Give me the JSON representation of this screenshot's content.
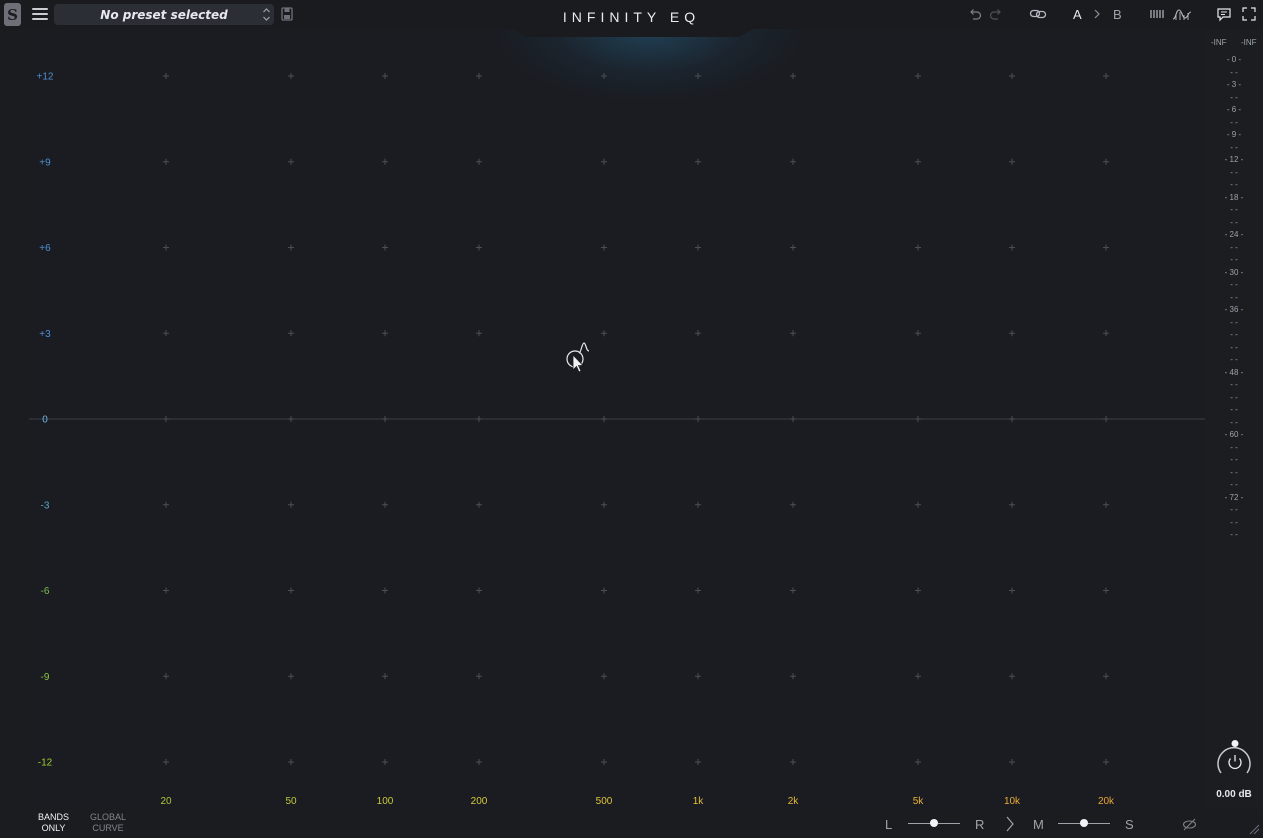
{
  "header": {
    "logo_letter": "S",
    "preset_label": "No preset selected",
    "app_title": "INFINITY EQ",
    "ab_a": "A",
    "ab_b": "B"
  },
  "graph": {
    "db_labels": [
      "+12",
      "+9",
      "+6",
      "+3",
      "0",
      "-3",
      "-6",
      "-9",
      "-12"
    ],
    "db_label_colors": [
      "#4f8fd6",
      "#4f8fd6",
      "#4f8fd6",
      "#4f8fd6",
      "#6fb3e8",
      "#5aa7c8",
      "#7cbf52",
      "#8cc63f",
      "#9bd12e"
    ],
    "freq_labels": [
      "20",
      "50",
      "100",
      "200",
      "500",
      "1k",
      "2k",
      "5k",
      "10k",
      "20k"
    ],
    "freq_label_colors": [
      "#a8c93a",
      "#c0c93a",
      "#c9c93a",
      "#d6c93a",
      "#e0c43a",
      "#e6bf3a",
      "#e8b83a",
      "#eab23a",
      "#ecab38",
      "#eea436"
    ]
  },
  "meter": {
    "left_head": "-INF",
    "right_head": "-INF",
    "ticks": [
      "0",
      "-",
      "3",
      "-",
      "6",
      "-",
      "9",
      "-",
      "12",
      "-",
      "-",
      "18",
      "-",
      "-",
      "24",
      "-",
      "-",
      "30",
      "-",
      "-",
      "36",
      "-",
      "-",
      "-",
      "-",
      "48",
      "-",
      "-",
      "-",
      "-",
      "60",
      "-",
      "-",
      "-",
      "-",
      "72",
      "-",
      "-",
      "-"
    ],
    "gain_value": "0.00 dB"
  },
  "footer": {
    "bands_only": [
      "BANDS",
      "ONLY"
    ],
    "global_curve": [
      "GLOBAL",
      "CURVE"
    ],
    "left": "L",
    "right": "R",
    "mid": "M",
    "side": "S",
    "pan_value": 0.5,
    "ms_value": 0.5
  },
  "colors": {
    "accent": "#2f8fc0",
    "grid_cross": "#4a4e56",
    "zero_line": "#3b3f47"
  }
}
